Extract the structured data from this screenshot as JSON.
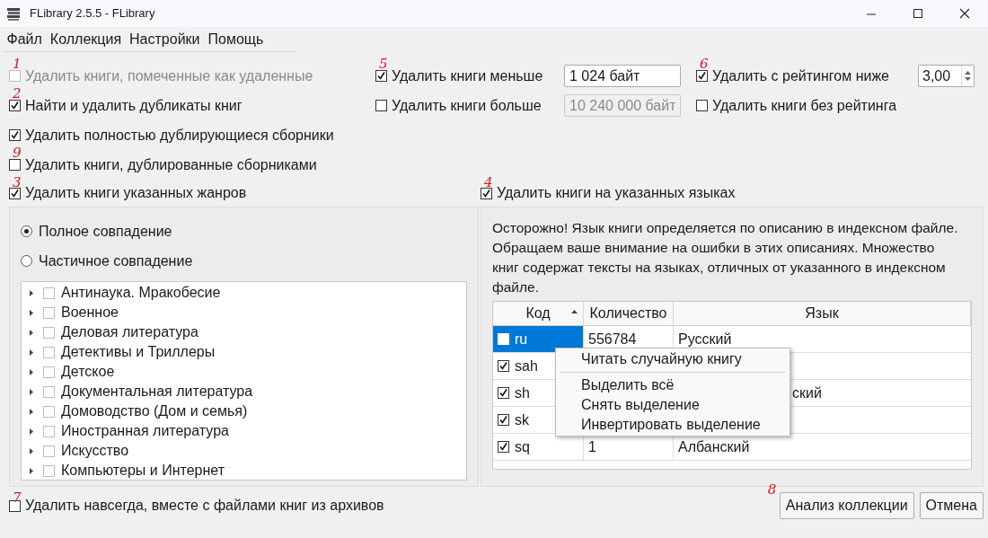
{
  "window": {
    "title": "FLibrary 2.5.5 - FLibrary"
  },
  "menu": [
    {
      "label": "Файл"
    },
    {
      "label": "Коллекция"
    },
    {
      "label": "Настройки"
    },
    {
      "label": "Помощь"
    }
  ],
  "options_left": [
    {
      "label": "Удалить книги, помеченные как удаленные",
      "checked": false,
      "disabled": true,
      "annotation": "1"
    },
    {
      "label": "Найти и удалить дубликаты книг",
      "checked": true,
      "disabled": false,
      "annotation": "2"
    },
    {
      "label": "Удалить полностью дублирующиеся сборники",
      "checked": true,
      "disabled": false
    },
    {
      "label": "Удалить книги, дублированные сборниками",
      "checked": false,
      "disabled": false,
      "annotation": "9"
    }
  ],
  "options_middle": [
    {
      "label": "Удалить книги меньше",
      "checked": true,
      "field": {
        "value": "1 024 байт",
        "disabled": false
      },
      "annotation": "5"
    },
    {
      "label": "Удалить книги больше",
      "checked": false,
      "field": {
        "value": "10 240 000 байт",
        "disabled": true
      }
    }
  ],
  "options_right": [
    {
      "kind": "spin",
      "label": "Удалить с рейтингом ниже",
      "checked": true,
      "value": "3,00",
      "annotation": "6"
    },
    {
      "kind": "plain",
      "label": "Удалить книги без рейтинга",
      "checked": false
    }
  ],
  "genres": {
    "checkbox": {
      "label": "Удалить книги указанных жанров",
      "checked": true,
      "annotation": "3"
    },
    "radios": [
      {
        "label": "Полное совпадение",
        "selected": true
      },
      {
        "label": "Частичное совпадение",
        "selected": false
      }
    ],
    "tree": [
      {
        "label": "Антинаука. Мракобесие",
        "checked": false,
        "expanded": false
      },
      {
        "label": "Военное",
        "checked": false,
        "expanded": false
      },
      {
        "label": "Деловая литература",
        "checked": false,
        "expanded": false
      },
      {
        "label": "Детективы и Триллеры",
        "checked": false,
        "expanded": false
      },
      {
        "label": "Детское",
        "checked": false,
        "expanded": false
      },
      {
        "label": "Документальная литература",
        "checked": false,
        "expanded": false
      },
      {
        "label": "Домоводство (Дом и семья)",
        "checked": false,
        "expanded": false
      },
      {
        "label": "Иностранная литература",
        "checked": false,
        "expanded": false
      },
      {
        "label": "Искусство",
        "checked": false,
        "expanded": false
      },
      {
        "label": "Компьютеры и Интернет",
        "checked": false,
        "expanded": false
      }
    ]
  },
  "languages": {
    "checkbox": {
      "label": "Удалить книги на указанных языках",
      "checked": true,
      "annotation": "4"
    },
    "warning": "Осторожно! Язык книги определяется по описанию в индексном файле. Обращаем ваше внимание на ошибки в этих описаниях. Множество книг содержат тексты на языках, отличных от указанного в индексном файле.",
    "table": {
      "columns": [
        {
          "label": "Код",
          "sorted": true
        },
        {
          "label": "Количество",
          "sorted": false
        },
        {
          "label": "Язык",
          "sorted": false
        }
      ],
      "rows": [
        {
          "code": "ru",
          "checked": false,
          "selected": true,
          "covered": false,
          "count": "556784",
          "language": "Русский"
        },
        {
          "code": "sah",
          "checked": true,
          "selected": false,
          "covered": true
        },
        {
          "code": "sh",
          "checked": true,
          "selected": false,
          "covered": true,
          "language": "ский"
        },
        {
          "code": "sk",
          "checked": true,
          "selected": false,
          "covered": true
        },
        {
          "code": "sq",
          "checked": true,
          "selected": false,
          "covered": false,
          "count": "1",
          "language": "Албанский"
        }
      ]
    },
    "context_menu": [
      {
        "kind": "item",
        "label": "Читать случайную книгу"
      },
      {
        "kind": "separator"
      },
      {
        "kind": "item",
        "label": "Выделить всё"
      },
      {
        "kind": "item",
        "label": "Снять выделение"
      },
      {
        "kind": "item",
        "label": "Инвертировать выделение"
      }
    ]
  },
  "footer": {
    "checkbox": {
      "label": "Удалить навсегда, вместе с файлами книг из архивов",
      "checked": false,
      "annotation": "7"
    },
    "buttons": [
      {
        "label": "Анализ коллекции",
        "annotation": "8"
      },
      {
        "label": "Отмена"
      }
    ]
  }
}
